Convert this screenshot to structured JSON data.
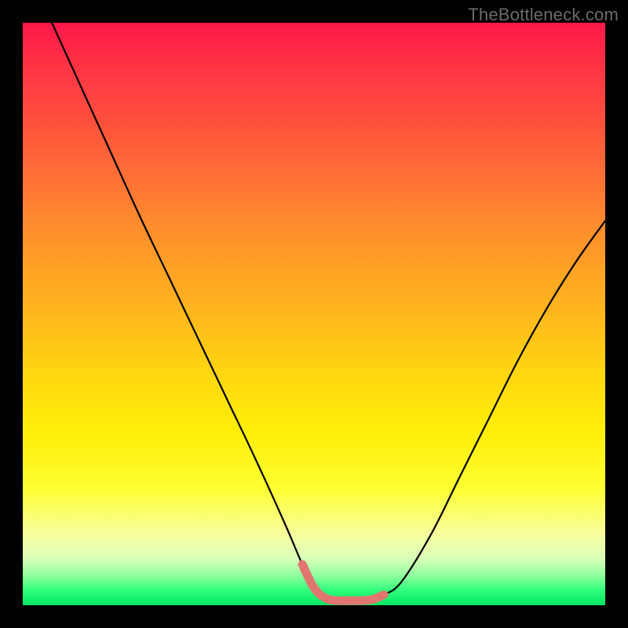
{
  "watermark": "TheBottleneck.com",
  "chart_data": {
    "type": "line",
    "title": "",
    "xlabel": "",
    "ylabel": "",
    "xlim": [
      0,
      100
    ],
    "ylim": [
      0,
      100
    ],
    "grid": false,
    "legend": false,
    "series": [
      {
        "name": "bottleneck-curve",
        "color": "#000000",
        "x": [
          5,
          10,
          15,
          20,
          25,
          30,
          35,
          40,
          45,
          48,
          50,
          52,
          54,
          56,
          58,
          60,
          62,
          65,
          70,
          75,
          80,
          85,
          90,
          95,
          100
        ],
        "values": [
          100,
          89,
          78,
          67,
          56.5,
          46,
          35.5,
          25,
          14,
          7,
          3,
          1.2,
          0.8,
          0.8,
          0.8,
          1.0,
          1.8,
          4,
          12,
          22,
          32,
          42,
          51,
          59,
          66
        ]
      },
      {
        "name": "optimal-band",
        "color": "#e0766f",
        "x": [
          48,
          50,
          52,
          54,
          56,
          58,
          60,
          62
        ],
        "values": [
          7,
          3,
          1.2,
          0.8,
          0.8,
          0.8,
          1.0,
          1.8
        ]
      }
    ],
    "annotations": []
  },
  "colors": {
    "gradient_top": "#ff1749",
    "gradient_mid": "#ffd60f",
    "gradient_bottom": "#00e765",
    "curve": "#000000",
    "optimal_band": "#e0766f"
  }
}
